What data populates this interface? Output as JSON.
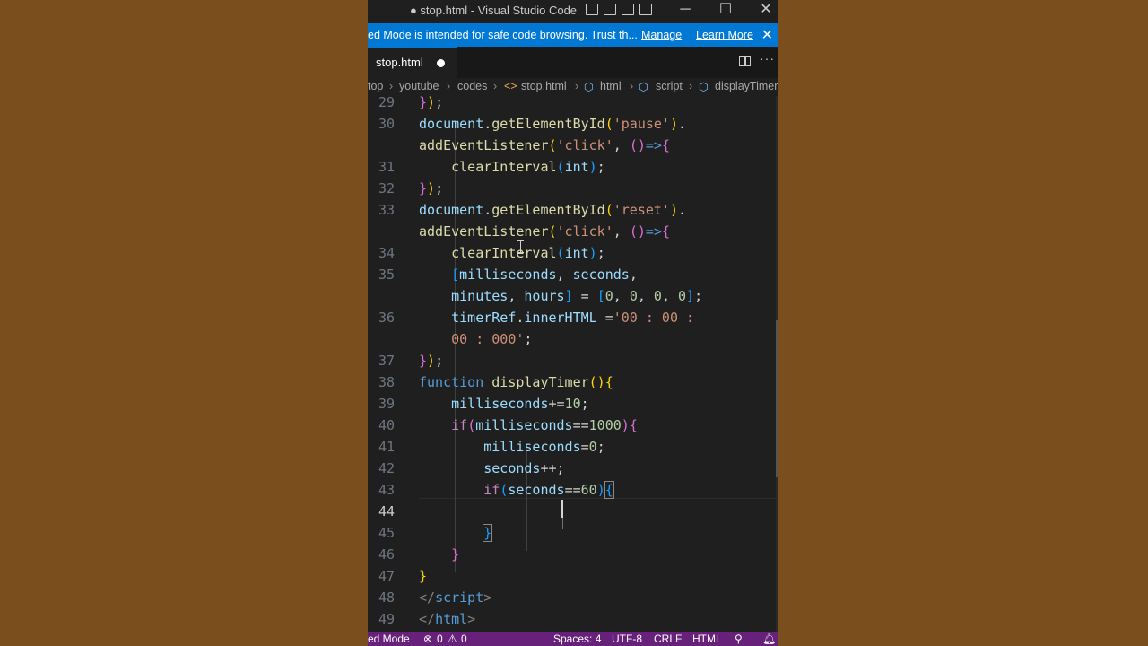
{
  "window": {
    "title": "● stop.html - Visual Studio Code"
  },
  "banner": {
    "message": "ed Mode is intended for safe code browsing. Trust th...",
    "manage": "Manage",
    "learn_more": "Learn More"
  },
  "tab": {
    "label": "stop.html"
  },
  "breadcrumb": [
    "top",
    "youtube",
    "codes",
    "stop.html",
    "html",
    "script",
    "displayTimer"
  ],
  "editor": {
    "active_line": "44"
  },
  "statusbar": {
    "mode": "ed Mode",
    "errors": "0",
    "warnings": "0",
    "spaces": "Spaces: 4",
    "encoding": "UTF-8",
    "eol": "CRLF",
    "language": "HTML"
  },
  "colors": {
    "status_bar": "#68217a",
    "banner": "#0078d4",
    "editor_bg": "#1f1f1f"
  },
  "code": [
    {
      "n": "29",
      "html": "<span class='b2'>}</span><span class='b1'>)</span><span class='w'>;</span>"
    },
    {
      "n": "30",
      "html": "<span class='v'>document</span><span class='w'>.</span><span class='f'>getElementById</span><span class='b1'>(</span><span class='s'>'pause'</span><span class='b1'>)</span><span class='w'>.</span>"
    },
    {
      "n": "",
      "html": "<span class='f'>addEventListener</span><span class='b1'>(</span><span class='s'>'click'</span><span class='w'>, </span><span class='b2'>()</span><span class='k'>=&gt;</span><span class='b2'>{</span>"
    },
    {
      "n": "31",
      "html": "    <span class='f'>clearInterval</span><span class='b3'>(</span><span class='v'>int</span><span class='b3'>)</span><span class='w'>;</span>"
    },
    {
      "n": "32",
      "html": "<span class='b2'>}</span><span class='b1'>)</span><span class='w'>;</span>"
    },
    {
      "n": "33",
      "html": "<span class='v'>document</span><span class='w'>.</span><span class='f'>getElementById</span><span class='b1'>(</span><span class='s'>'reset'</span><span class='b1'>)</span><span class='w'>.</span>"
    },
    {
      "n": "",
      "html": "<span class='f'>addEventListener</span><span class='b1'>(</span><span class='s'>'click'</span><span class='w'>, </span><span class='b2'>()</span><span class='k'>=&gt;</span><span class='b2'>{</span>"
    },
    {
      "n": "34",
      "html": "    <span class='f'>clearInterval</span><span class='b3'>(</span><span class='v'>int</span><span class='b3'>)</span><span class='w'>;</span>"
    },
    {
      "n": "35",
      "html": "    <span class='b3'>[</span><span class='v'>milliseconds</span><span class='w'>, </span><span class='v'>seconds</span><span class='w'>,</span>"
    },
    {
      "n": "",
      "html": "    <span class='v'>minutes</span><span class='w'>, </span><span class='v'>hours</span><span class='b3'>]</span><span class='w'> = </span><span class='b3'>[</span><span class='n'>0</span><span class='w'>, </span><span class='n'>0</span><span class='w'>, </span><span class='n'>0</span><span class='w'>, </span><span class='n'>0</span><span class='b3'>]</span><span class='w'>;</span>"
    },
    {
      "n": "36",
      "html": "    <span class='v'>timerRef</span><span class='w'>.</span><span class='v'>innerHTML</span><span class='w'> =</span><span class='s'>'00 : 00 :</span>"
    },
    {
      "n": "",
      "html": "    <span class='s'>00 : 000'</span><span class='w'>;</span>"
    },
    {
      "n": "37",
      "html": "<span class='b2'>}</span><span class='b1'>)</span><span class='w'>;</span>"
    },
    {
      "n": "38",
      "html": "<span class='k'>function</span><span class='w'> </span><span class='f'>displayTimer</span><span class='b1'>()</span><span class='b1'>{</span>"
    },
    {
      "n": "39",
      "html": "    <span class='v'>milliseconds</span><span class='w'>+=</span><span class='n'>10</span><span class='w'>;</span>"
    },
    {
      "n": "40",
      "html": "    <span class='c'>if</span><span class='b2'>(</span><span class='v'>milliseconds</span><span class='w'>==</span><span class='n'>1000</span><span class='b2'>)</span><span class='b2'>{</span>"
    },
    {
      "n": "41",
      "html": "        <span class='v'>milliseconds</span><span class='w'>=</span><span class='n'>0</span><span class='w'>;</span>"
    },
    {
      "n": "42",
      "html": "        <span class='v'>seconds</span><span class='w'>++;</span>"
    },
    {
      "n": "43",
      "html": "        <span class='c'>if</span><span class='b3'>(</span><span class='v'>seconds</span><span class='w'>==</span><span class='n'>60</span><span class='b3'>)</span><span class='b3 match'>{</span>"
    },
    {
      "n": "44",
      "html": ""
    },
    {
      "n": "45",
      "html": "        <span class='b3 match'>}</span>"
    },
    {
      "n": "46",
      "html": "    <span class='b2'>}</span>"
    },
    {
      "n": "47",
      "html": "<span class='b1'>}</span>"
    },
    {
      "n": "48",
      "html": "<span class='t'>&lt;/</span><span class='k'>script</span><span class='t'>&gt;</span>"
    },
    {
      "n": "49",
      "html": "<span class='t'>&lt;/</span><span class='k'>html</span><span class='t'>&gt;</span>"
    }
  ]
}
